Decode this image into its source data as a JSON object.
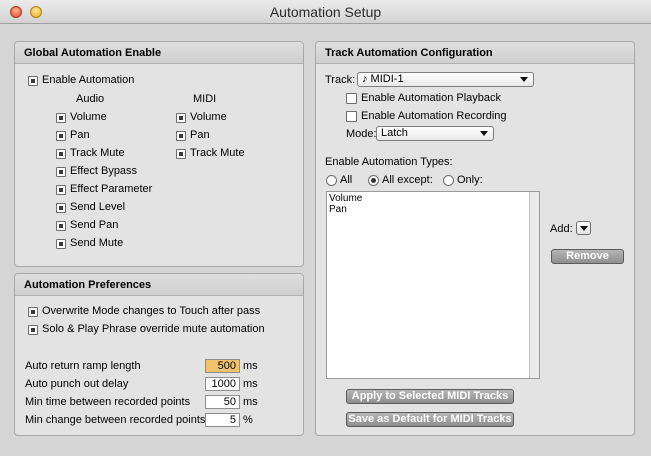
{
  "window": {
    "title": "Automation Setup"
  },
  "global_enable": {
    "heading": "Global Automation Enable",
    "enable_automation": {
      "label": "Enable Automation",
      "checked": true
    },
    "audio_heading": "Audio",
    "midi_heading": "MIDI",
    "audio_items": [
      {
        "label": "Volume",
        "checked": true
      },
      {
        "label": "Pan",
        "checked": true
      },
      {
        "label": "Track Mute",
        "checked": true
      },
      {
        "label": "Effect Bypass",
        "checked": true
      },
      {
        "label": "Effect Parameter",
        "checked": true
      },
      {
        "label": "Send Level",
        "checked": true
      },
      {
        "label": "Send Pan",
        "checked": true
      },
      {
        "label": "Send Mute",
        "checked": true
      }
    ],
    "midi_items": [
      {
        "label": "Volume",
        "checked": true
      },
      {
        "label": "Pan",
        "checked": true
      },
      {
        "label": "Track Mute",
        "checked": true
      }
    ]
  },
  "preferences": {
    "heading": "Automation Preferences",
    "overwrite": {
      "label": "Overwrite Mode changes to Touch after pass",
      "checked": true
    },
    "solo": {
      "label": "Solo & Play Phrase override mute automation",
      "checked": true
    },
    "fields": [
      {
        "label": "Auto return ramp length",
        "value": "500",
        "unit": "ms"
      },
      {
        "label": "Auto punch out delay",
        "value": "1000",
        "unit": "ms"
      },
      {
        "label": "Min time between recorded points",
        "value": "50",
        "unit": "ms"
      },
      {
        "label": "Min change between recorded points",
        "value": "5",
        "unit": "%"
      }
    ]
  },
  "track_config": {
    "heading": "Track Automation Configuration",
    "track_label": "Track:",
    "track_value": "♪ MIDI-1",
    "enable_playback": {
      "label": "Enable Automation Playback",
      "checked": false
    },
    "enable_recording": {
      "label": "Enable Automation Recording",
      "checked": false
    },
    "mode_label": "Mode:",
    "mode_value": "Latch",
    "types_label": "Enable Automation Types:",
    "radio_all": "All",
    "radio_all_except": "All except:",
    "radio_only": "Only:",
    "selected_radio": "All except:",
    "types_list": [
      "Volume",
      "Pan"
    ],
    "add_label": "Add:",
    "remove_button": "Remove",
    "apply_button": "Apply to Selected MIDI Tracks",
    "save_default_button": "Save as Default for MIDI Tracks"
  }
}
